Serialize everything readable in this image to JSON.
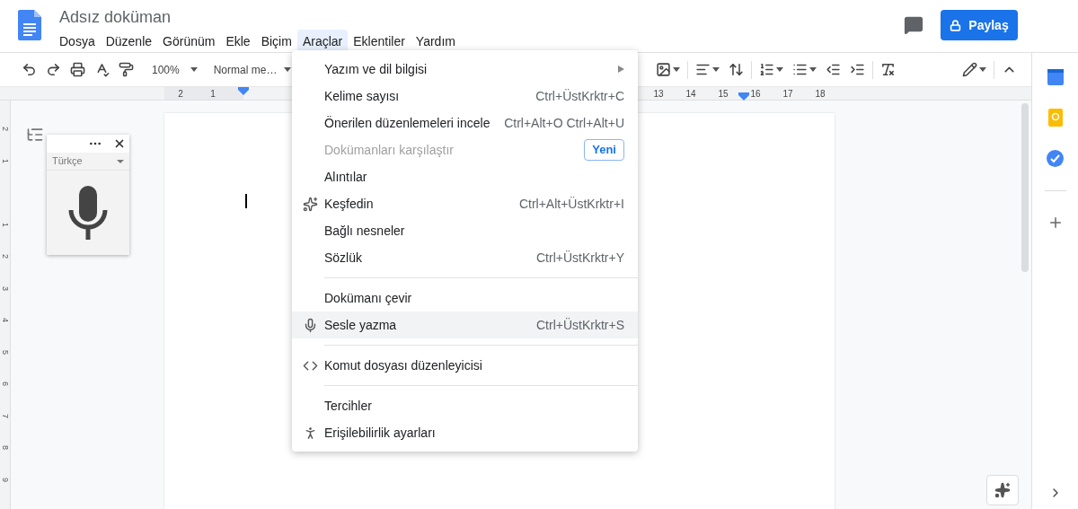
{
  "document": {
    "title": "Adsız doküman",
    "cursor_visible": true
  },
  "menubar": [
    {
      "label": "Dosya",
      "selected": false
    },
    {
      "label": "Düzenle",
      "selected": false
    },
    {
      "label": "Görünüm",
      "selected": false
    },
    {
      "label": "Ekle",
      "selected": false
    },
    {
      "label": "Biçim",
      "selected": false
    },
    {
      "label": "Araçlar",
      "selected": true
    },
    {
      "label": "Eklentiler",
      "selected": false
    },
    {
      "label": "Yardım",
      "selected": false
    }
  ],
  "share_button": {
    "label": "Paylaş"
  },
  "toolbar": {
    "zoom": "100%",
    "style": "Normal me…"
  },
  "ruler": {
    "left_labels": [
      "2",
      "1"
    ],
    "right_labels": [
      "13",
      "14",
      "15",
      "16",
      "17",
      "18"
    ]
  },
  "vertical_ruler": {
    "top_labels": [
      "2",
      "1"
    ],
    "bottom_labels": [
      "1",
      "2",
      "3",
      "4",
      "5",
      "6",
      "7",
      "8",
      "9"
    ]
  },
  "voice_widget": {
    "language": "Türkçe"
  },
  "tools_menu": [
    {
      "kind": "item",
      "label": "Yazım ve dil bilgisi",
      "submenu": true,
      "selected": false,
      "disabled": false
    },
    {
      "kind": "item",
      "label": "Kelime sayısı",
      "shortcut": "Ctrl+ÜstKrktr+C",
      "selected": false,
      "disabled": false
    },
    {
      "kind": "item",
      "label": "Önerilen düzenlemeleri incele",
      "shortcut": "Ctrl+Alt+O Ctrl+Alt+U",
      "selected": false,
      "disabled": false
    },
    {
      "kind": "item",
      "label": "Dokümanları karşılaştır",
      "badge": "Yeni",
      "selected": false,
      "disabled": true
    },
    {
      "kind": "item",
      "label": "Alıntılar",
      "selected": false,
      "disabled": false
    },
    {
      "kind": "explore",
      "label": "Keşfedin",
      "shortcut": "Ctrl+Alt+ÜstKrktr+I",
      "selected": false,
      "disabled": false
    },
    {
      "kind": "item",
      "label": "Bağlı nesneler",
      "selected": false,
      "disabled": false
    },
    {
      "kind": "item",
      "label": "Sözlük",
      "shortcut": "Ctrl+ÜstKrktr+Y",
      "selected": false,
      "disabled": false
    },
    {
      "kind": "separator"
    },
    {
      "kind": "item",
      "label": "Dokümanı çevir",
      "selected": false,
      "disabled": false
    },
    {
      "kind": "voice",
      "label": "Sesle yazma",
      "shortcut": "Ctrl+ÜstKrktr+S",
      "selected": true,
      "disabled": false
    },
    {
      "kind": "separator"
    },
    {
      "kind": "script",
      "label": "Komut dosyası düzenleyicisi",
      "selected": false,
      "disabled": false
    },
    {
      "kind": "separator"
    },
    {
      "kind": "item",
      "label": "Tercihler",
      "selected": false,
      "disabled": false
    },
    {
      "kind": "accessibility",
      "label": "Erişilebilirlik ayarları",
      "selected": false,
      "disabled": false
    }
  ]
}
